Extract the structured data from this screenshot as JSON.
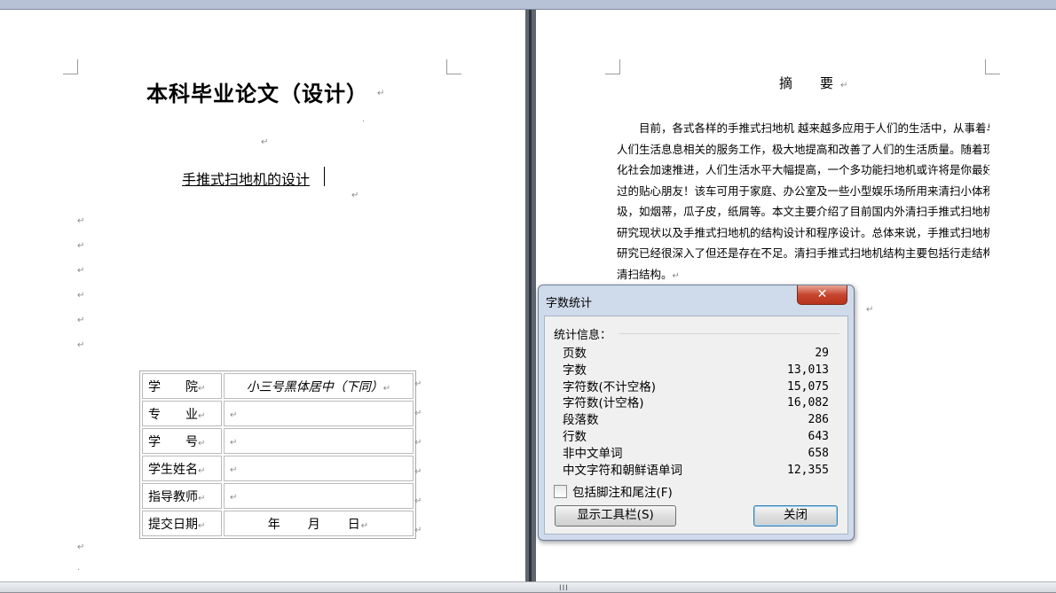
{
  "left_page": {
    "title": "本科毕业论文（设计）",
    "subtitle": "手推式扫地机的设计",
    "table": [
      {
        "label": "学　　院",
        "value": "小三号黑体居中（下同）"
      },
      {
        "label": "专　　业",
        "value": ""
      },
      {
        "label": "学　　号",
        "value": ""
      },
      {
        "label": "学生姓名",
        "value": ""
      },
      {
        "label": "指导教师",
        "value": ""
      },
      {
        "label": "提交日期",
        "value": "年　　月　　日"
      }
    ]
  },
  "right_page": {
    "heading": "摘　要",
    "lines": [
      "　　目前，各式各样的手推式扫地机 越来越多应用于人们的生活中，从事着与",
      "人们生活息息相关的服务工作，极大地提高和改善了人们的生活质量。随着现代",
      "化社会加速推进，人们生活水平大幅提高，一个多功能扫地机或许将是你最好不",
      "过的贴心朋友！该车可用于家庭、办公室及一些小型娱乐场所用来清扫小体积垃",
      "圾，如烟蒂，瓜子皮，纸屑等。本文主要介绍了目前国内外清扫手推式扫地机的",
      "研究现状以及手推式扫地机的结构设计和程序设计。总体来说，手推式扫地机的",
      "研究已经很深入了但还是存在不足。清扫手推式扫地机结构主要包括行走结构、",
      "清扫结构。"
    ]
  },
  "marks": {
    "para": "↵",
    "small": "·"
  },
  "dialog": {
    "title": "字数统计",
    "close_glyph": "✕",
    "section_label": "统计信息：",
    "stats": [
      {
        "label": "页数",
        "value": "29"
      },
      {
        "label": "字数",
        "value": "13,013"
      },
      {
        "label": "字符数(不计空格)",
        "value": "15,075"
      },
      {
        "label": "字符数(计空格)",
        "value": "16,082"
      },
      {
        "label": "段落数",
        "value": "286"
      },
      {
        "label": "行数",
        "value": "643"
      },
      {
        "label": "非中文单词",
        "value": "658"
      },
      {
        "label": "中文字符和朝鲜语单词",
        "value": "12,355"
      }
    ],
    "checkbox_label": "包括脚注和尾注(F)",
    "checkbox_checked": false,
    "show_toolbar_label": "显示工具栏(S)",
    "close_label": "关闭"
  },
  "scroll_grip": "III"
}
